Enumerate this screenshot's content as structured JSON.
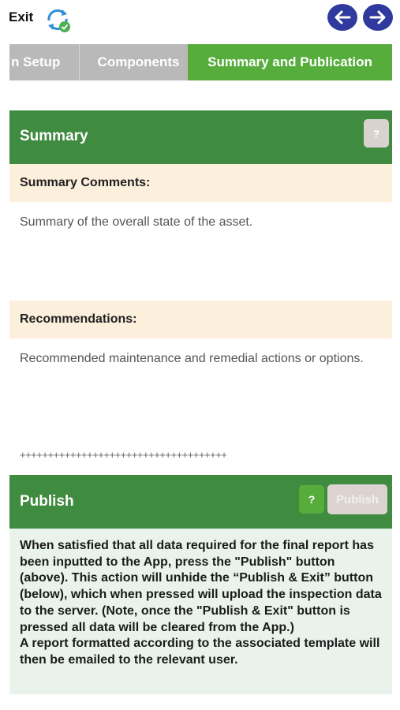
{
  "header": {
    "exit_label": "Exit",
    "sync_icon": "sync-check-icon",
    "back_icon": "arrow-left-icon",
    "forward_icon": "arrow-right-icon",
    "nav_color": "#2e3a9e"
  },
  "tabs": [
    {
      "label": "n Setup",
      "active": false
    },
    {
      "label": "Components",
      "active": false
    },
    {
      "label": "Summary and Publication",
      "active": true
    }
  ],
  "summary": {
    "title": "Summary",
    "help_label": "?",
    "comments_label": "Summary Comments:",
    "comments_text": "Summary of the overall state of the asset.",
    "recommendations_label": "Recommendations:",
    "recommendations_text": "Recommended maintenance and remedial actions or options.",
    "divider": "+++++++++++++++++++++++++++++++++++++"
  },
  "publish": {
    "title": "Publish",
    "help_label": "?",
    "button_label": "Publish",
    "info_paragraphs": [
      "When satisfied that all data required for the final report has been inputted to the App, press the \"Publish\" button (above). This action will unhide the “Publish & Exit” button (below), which when pressed will upload the inspection data to the server. (Note, once the \"Publish & Exit\" button is pressed all data will be cleared from the App.)",
      "A report formatted according to the associated template will then be emailed to the relevant user."
    ]
  },
  "colors": {
    "header_green": "#3f8b40",
    "active_tab_green": "#56ad3c",
    "inactive_tab_grey": "#b9b9b9",
    "label_bg": "#fcefdc",
    "info_bg": "#e9f3ec"
  }
}
